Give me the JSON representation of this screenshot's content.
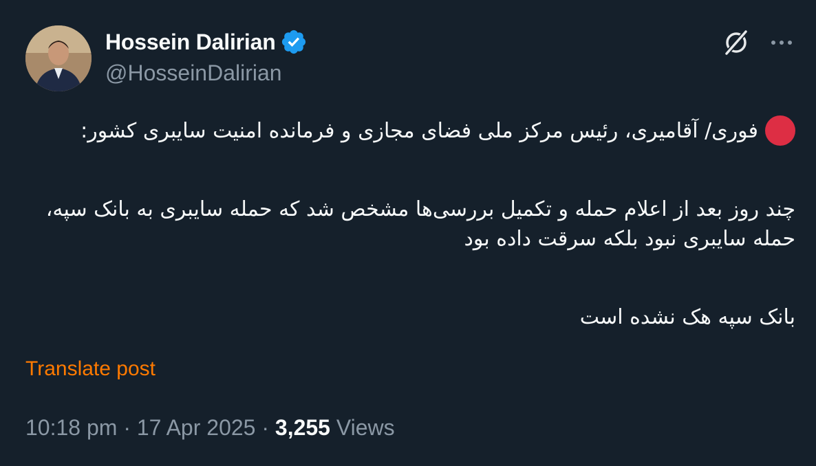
{
  "author": {
    "display_name": "Hossein Dalirian",
    "handle": "@HosseinDalirian",
    "verified_icon": "verified-badge-icon",
    "verified_color": "#1d9bf0"
  },
  "header_icons": {
    "grok": "grok-icon",
    "more": "more-options-icon"
  },
  "post": {
    "line1_text": "فوری/ آقامیری، رئیس مرکز ملی فضای مجازی و فرمانده امنیت سایبری کشور:",
    "line1_emoji": "red-circle",
    "para2": "چند روز بعد از اعلام حمله و تکمیل بررسی‌ها مشخص شد که حمله سایبری به بانک سپه، حمله سایبری نبود بلکه سرقت داده بود",
    "para3": "بانک سپه هک نشده است"
  },
  "translate_label": "Translate post",
  "meta": {
    "time": "10:18 pm",
    "separator": "·",
    "date": "17 Apr 2025",
    "views_count": "3,255",
    "views_label": "Views"
  },
  "colors": {
    "background": "#15202b",
    "text": "#f7f9f9",
    "muted": "#8b98a5",
    "translate": "#ff7a00",
    "red_dot": "#dd2e44"
  }
}
